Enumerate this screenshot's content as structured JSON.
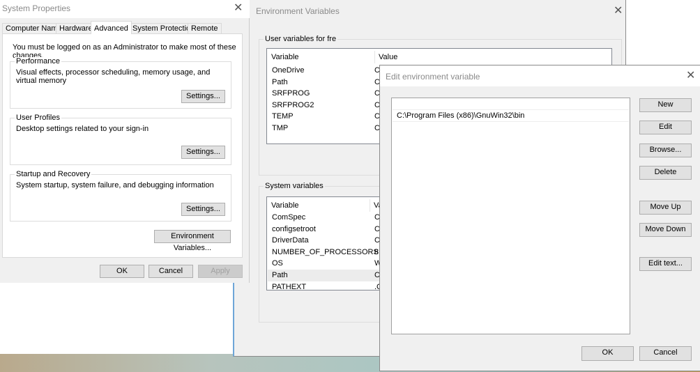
{
  "system_properties": {
    "title": "System Properties",
    "tabs": [
      "Computer Name",
      "Hardware",
      "Advanced",
      "System Protection",
      "Remote"
    ],
    "selected_tab": "Advanced",
    "notice": "You must be logged on as an Administrator to make most of these changes.",
    "groups": [
      {
        "label": "Performance",
        "description": "Visual effects, processor scheduling, memory usage, and virtual memory",
        "button": "Settings..."
      },
      {
        "label": "User Profiles",
        "description": "Desktop settings related to your sign-in",
        "button": "Settings..."
      },
      {
        "label": "Startup and Recovery",
        "description": "System startup, system failure, and debugging information",
        "button": "Settings..."
      }
    ],
    "env_button": "Environment Variables...",
    "ok": "OK",
    "cancel": "Cancel",
    "apply": "Apply"
  },
  "env_vars": {
    "title": "Environment Variables",
    "user_group": "User variables for fre",
    "col_variable": "Variable",
    "col_value": "Value",
    "col_value_truncated": "Va",
    "user_rows": [
      {
        "name": "OneDrive",
        "value": "C:"
      },
      {
        "name": "Path",
        "value": "C:"
      },
      {
        "name": "SRFPROG",
        "value": "C:"
      },
      {
        "name": "SRFPROG2",
        "value": "C:"
      },
      {
        "name": "TEMP",
        "value": "C:"
      },
      {
        "name": "TMP",
        "value": "C:"
      }
    ],
    "system_group": "System variables",
    "system_rows": [
      {
        "name": "ComSpec",
        "value": "C:"
      },
      {
        "name": "configsetroot",
        "value": "C:"
      },
      {
        "name": "DriverData",
        "value": "C:"
      },
      {
        "name": "NUMBER_OF_PROCESSORS",
        "value": "8"
      },
      {
        "name": "OS",
        "value": "W"
      },
      {
        "name": "Path",
        "value": "C:"
      },
      {
        "name": "PATHEXT",
        "value": ".C"
      }
    ],
    "selected_system_row": "Path"
  },
  "edit_var": {
    "title": "Edit environment variable",
    "entries": [
      "",
      "C:\\Program Files (x86)\\GnuWin32\\bin"
    ],
    "buttons": {
      "new": "New",
      "edit": "Edit",
      "browse": "Browse...",
      "delete": "Delete",
      "move_up": "Move Up",
      "move_down": "Move Down",
      "edit_text": "Edit text..."
    },
    "ok": "OK",
    "cancel": "Cancel"
  }
}
